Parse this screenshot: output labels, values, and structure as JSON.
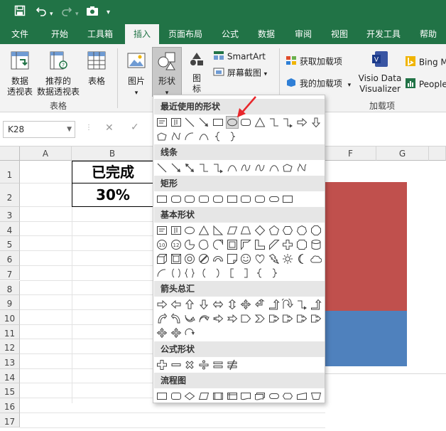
{
  "quick_access": {
    "save_icon": "save-icon",
    "undo_icon": "undo-icon",
    "redo_icon": "redo-icon",
    "camera_icon": "camera-icon",
    "customize_icon": "chevron-down-icon"
  },
  "tabs": [
    "文件",
    "开始",
    "工具箱",
    "插入",
    "页面布局",
    "公式",
    "数据",
    "审阅",
    "视图",
    "开发工具",
    "帮助"
  ],
  "active_tab": "插入",
  "ribbon": {
    "pivot_table": [
      "数据",
      "透视表"
    ],
    "recommended_pivot": [
      "推荐的",
      "数据透视表"
    ],
    "table": "表格",
    "group_tables": "表格",
    "pictures": "图片",
    "shapes": "形状",
    "icons": [
      "图",
      "标"
    ],
    "smartart": "SmartArt",
    "screenshot": "屏幕截图",
    "get_addins": "获取加载项",
    "my_addins": "我的加载项",
    "visio": [
      "Visio Data",
      "Visualizer"
    ],
    "bing": "Bing M",
    "people": "People",
    "group_addins": "加载项"
  },
  "formula_bar": {
    "name_box": "K28",
    "cancel_icon": "close-icon",
    "enter_icon": "check-icon"
  },
  "columns": [
    "A",
    "B",
    "F",
    "G"
  ],
  "rows": [
    "1",
    "2",
    "3",
    "4",
    "5",
    "6",
    "7",
    "8",
    "9",
    "10",
    "11",
    "12",
    "13",
    "14",
    "15",
    "16",
    "17"
  ],
  "cells": {
    "b1": "已完成",
    "b2": "30%"
  },
  "chart": {
    "top_color": "#c0504d",
    "bottom_color": "#4f81bd"
  },
  "shapes_menu": {
    "recent": "最近使用的形状",
    "lines": "线条",
    "rectangles": "矩形",
    "basic": "基本形状",
    "arrows": "箭头总汇",
    "equation": "公式形状",
    "flowchart": "流程图"
  }
}
